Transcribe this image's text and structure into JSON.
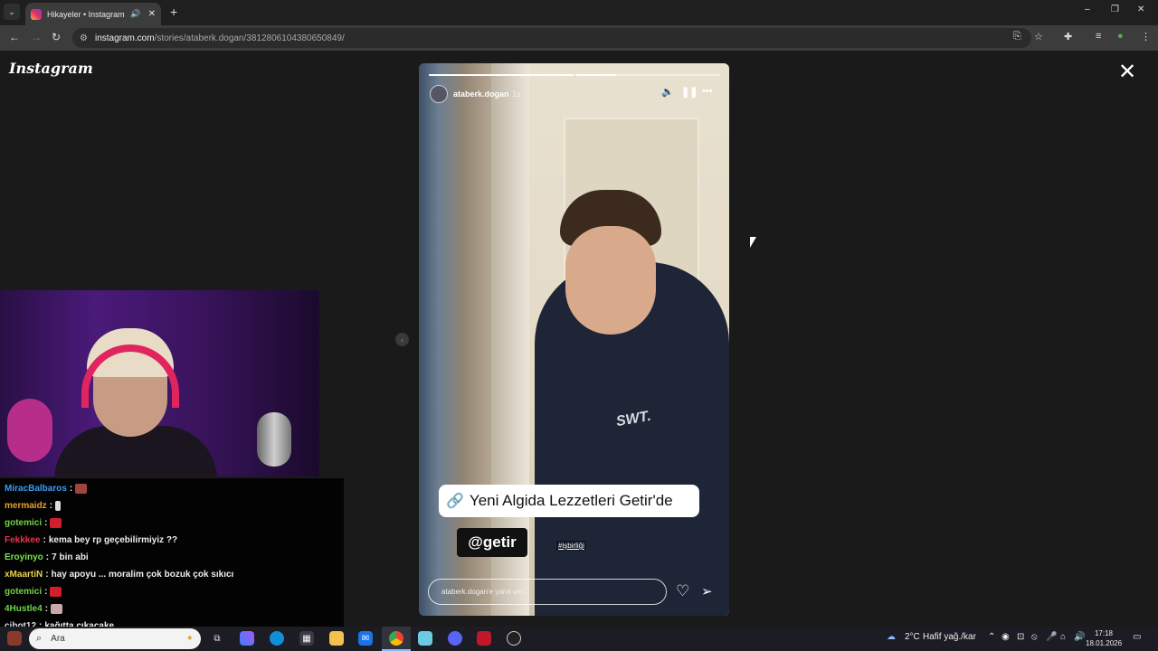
{
  "browser": {
    "tab_title": "Hikayeler • Instagram",
    "new_tab_label": "+",
    "url_site": "instagram.com",
    "url_path": "/stories/ataberk.dogan/3812806104380650849/",
    "window_controls": [
      "–",
      "❐",
      "✕"
    ]
  },
  "instagram": {
    "logo": "Instagram",
    "story": {
      "username": "ataberk.dogan",
      "time": "1s",
      "progress": [
        1.0,
        0.28,
        0.0
      ],
      "caption": "Yeni Algida Lezzetleri Getir'de",
      "mention": "getir",
      "tag": "#işbirliği",
      "shirt_logo": "SWT.",
      "reply_placeholder": "ataberk.dogan'e yanıt ver..."
    }
  },
  "chat": {
    "messages": [
      {
        "user": "MiracBalbaros",
        "color": "#3a9af5",
        "text": "",
        "emote": "#a0453d"
      },
      {
        "user": "mermaidz",
        "color": "#e8a12a",
        "text": "",
        "emote": "#dddddd"
      },
      {
        "user": "gotemici",
        "color": "#6fd24a",
        "text": "",
        "emote": "#d11f2b"
      },
      {
        "user": "Fekkkee",
        "color": "#e8344a",
        "text": "kema bey rp geçebilirmiyiz ??",
        "emote": ""
      },
      {
        "user": "Eroyinyo",
        "color": "#7ee04f",
        "text": "7 bin abi",
        "emote": ""
      },
      {
        "user": "xMaartiN",
        "color": "#e8d34a",
        "text": "hay apoyu ... moralim çok bozuk çok sıkıcı",
        "emote": ""
      },
      {
        "user": "gotemici",
        "color": "#6fd24a",
        "text": "",
        "emote": "#d11f2b"
      },
      {
        "user": "4Hustle4",
        "color": "#6fd24a",
        "text": "",
        "emote": "#c9a8a8"
      },
      {
        "user": "cibot12",
        "color": "#dddddd",
        "text": "kağıtta çıkacake",
        "emote": ""
      }
    ]
  },
  "taskbar": {
    "search_placeholder": "Ara",
    "weather": "2°C",
    "weather_desc": "Hafif yağ./kar",
    "time": "17:18",
    "date": "18.01.2026"
  }
}
